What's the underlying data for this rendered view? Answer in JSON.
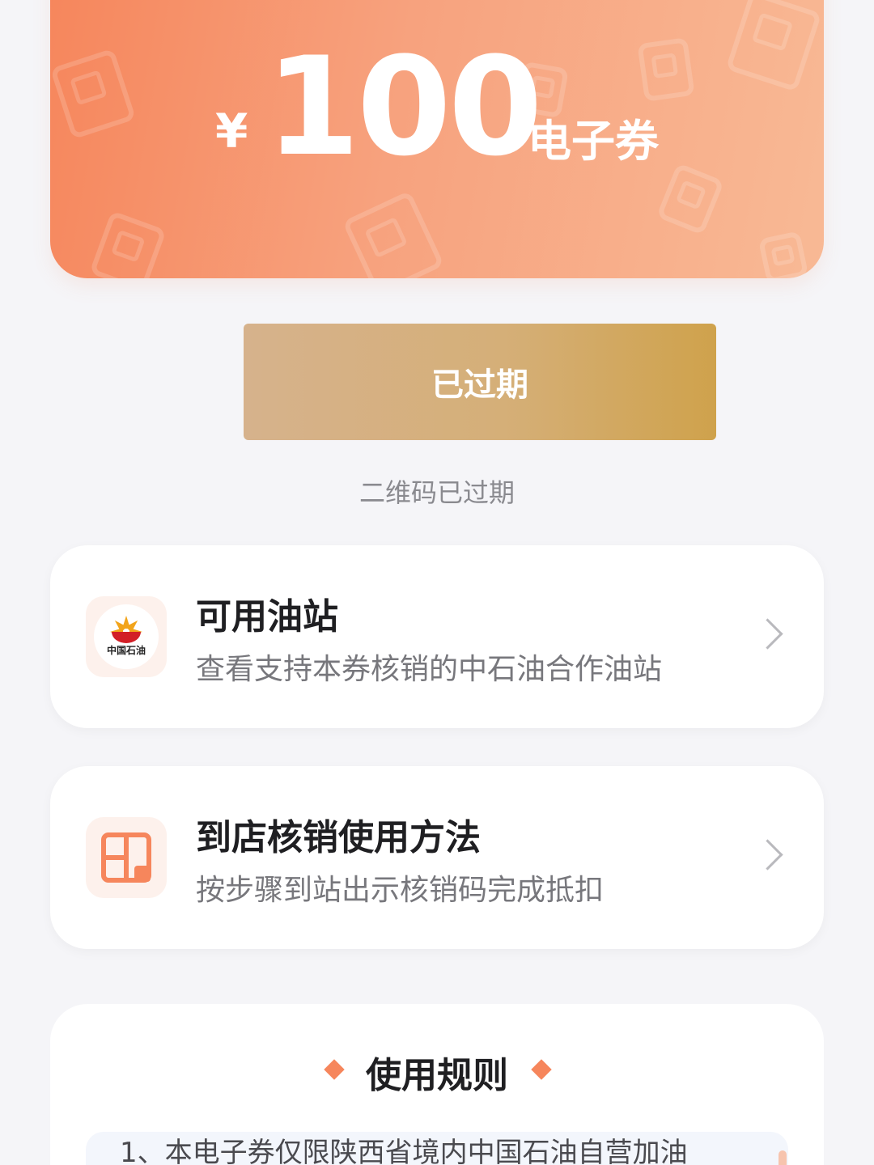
{
  "coupon": {
    "currency": "¥",
    "amount": "100",
    "type_label": "电子券"
  },
  "status": {
    "button_label": "已过期",
    "qr_note": "二维码已过期"
  },
  "cards": [
    {
      "title": "可用油站",
      "subtitle": "查看支持本券核销的中石油合作油站",
      "logo_text": "中国石油"
    },
    {
      "title": "到店核销使用方法",
      "subtitle": "按步骤到站出示核销码完成抵扣"
    }
  ],
  "rules": {
    "title": "使用规则",
    "first_line": "1、本电子券仅限陕西省境内中国石油自营加油"
  },
  "colors": {
    "coupon_start": "#f6865c",
    "coupon_end": "#f8b995",
    "button_start": "#d6b28c",
    "button_end": "#cfa24c",
    "accent": "#f6865c"
  },
  "icons": {
    "station_logo": "petrochina-logo-icon",
    "howto_icon": "grid-icon",
    "chevron": "chevron-right-icon",
    "diamond": "diamond-icon"
  }
}
